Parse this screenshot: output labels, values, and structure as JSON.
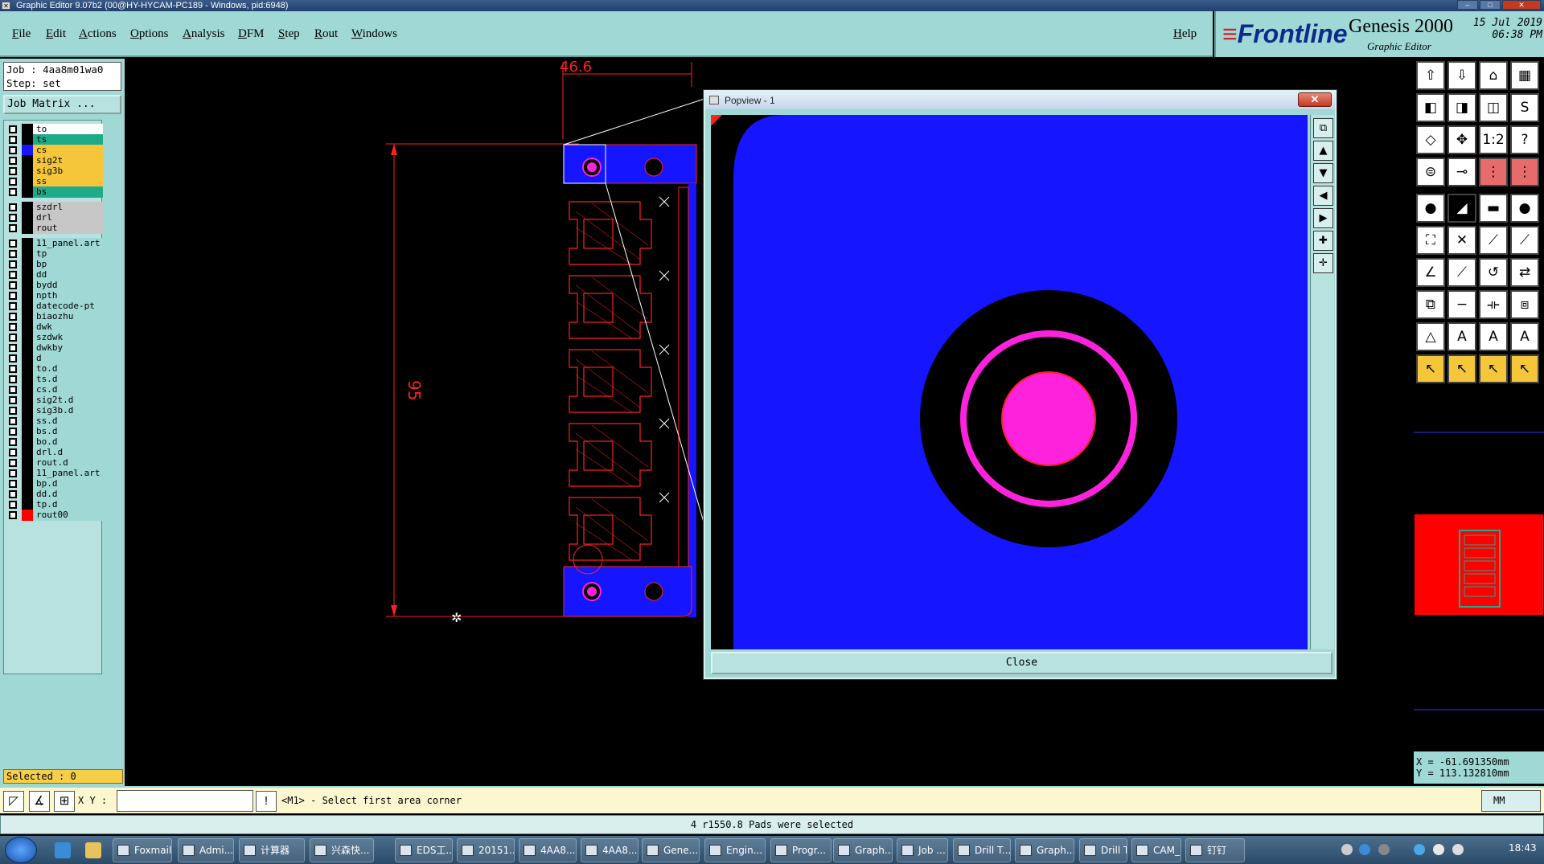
{
  "window": {
    "title": "Graphic Editor 9.07b2 (00@HY-HYCAM-PC189 - Windows, pid:6948)"
  },
  "menu": [
    "File",
    "Edit",
    "Actions",
    "Options",
    "Analysis",
    "DFM",
    "Step",
    "Rout",
    "Windows"
  ],
  "help_label": "Help",
  "brand": {
    "logo": "Frontline",
    "product": "Genesis 2000",
    "subtitle": "Graphic Editor",
    "date": "15 Jul 2019",
    "time": "06:38 PM"
  },
  "job": {
    "job_line": "Job : 4aa8m01wa0",
    "step_line": "Step: set",
    "matrix_button": "Job Matrix ..."
  },
  "layers": [
    {
      "name": "to",
      "color": "#ffffff",
      "swatch": "#000000"
    },
    {
      "name": "ts",
      "color": "#1faa8a",
      "swatch": "#000000"
    },
    {
      "name": "cs",
      "color": "#f5c63a",
      "swatch": "#1515ff"
    },
    {
      "name": "sig2t",
      "color": "#f5c63a",
      "swatch": "#000000"
    },
    {
      "name": "sig3b",
      "color": "#f5c63a",
      "swatch": "#000000"
    },
    {
      "name": "ss",
      "color": "#f5c63a",
      "swatch": "#000000"
    },
    {
      "name": "bs",
      "color": "#1faa8a",
      "swatch": "#000000"
    },
    {
      "name": "szdrl",
      "color": "#c7c7c7",
      "swatch": "#000000"
    },
    {
      "name": "drl",
      "color": "#c7c7c7",
      "swatch": "#000000"
    },
    {
      "name": "rout",
      "color": "#c7c7c7",
      "swatch": "#000000"
    },
    {
      "name": "11_panel.art",
      "color": "#9fd8d5",
      "swatch": "#000000"
    },
    {
      "name": "tp",
      "color": "#9fd8d5",
      "swatch": "#000000"
    },
    {
      "name": "bp",
      "color": "#9fd8d5",
      "swatch": "#000000"
    },
    {
      "name": "dd",
      "color": "#9fd8d5",
      "swatch": "#000000"
    },
    {
      "name": "bydd",
      "color": "#9fd8d5",
      "swatch": "#000000"
    },
    {
      "name": "npth",
      "color": "#9fd8d5",
      "swatch": "#000000"
    },
    {
      "name": "datecode-pt",
      "color": "#9fd8d5",
      "swatch": "#000000"
    },
    {
      "name": "biaozhu",
      "color": "#9fd8d5",
      "swatch": "#000000"
    },
    {
      "name": "dwk",
      "color": "#9fd8d5",
      "swatch": "#000000"
    },
    {
      "name": "szdwk",
      "color": "#9fd8d5",
      "swatch": "#000000"
    },
    {
      "name": "dwkby",
      "color": "#9fd8d5",
      "swatch": "#000000"
    },
    {
      "name": "d",
      "color": "#9fd8d5",
      "swatch": "#000000"
    },
    {
      "name": "to.d",
      "color": "#9fd8d5",
      "swatch": "#000000"
    },
    {
      "name": "ts.d",
      "color": "#9fd8d5",
      "swatch": "#000000"
    },
    {
      "name": "cs.d",
      "color": "#9fd8d5",
      "swatch": "#000000"
    },
    {
      "name": "sig2t.d",
      "color": "#9fd8d5",
      "swatch": "#000000"
    },
    {
      "name": "sig3b.d",
      "color": "#9fd8d5",
      "swatch": "#000000"
    },
    {
      "name": "ss.d",
      "color": "#9fd8d5",
      "swatch": "#000000"
    },
    {
      "name": "bs.d",
      "color": "#9fd8d5",
      "swatch": "#000000"
    },
    {
      "name": "bo.d",
      "color": "#9fd8d5",
      "swatch": "#000000"
    },
    {
      "name": "drl.d",
      "color": "#9fd8d5",
      "swatch": "#000000"
    },
    {
      "name": "rout.d",
      "color": "#9fd8d5",
      "swatch": "#000000"
    },
    {
      "name": "11_panel.art",
      "color": "#9fd8d5",
      "swatch": "#000000"
    },
    {
      "name": "bp.d",
      "color": "#9fd8d5",
      "swatch": "#000000"
    },
    {
      "name": "dd.d",
      "color": "#9fd8d5",
      "swatch": "#000000"
    },
    {
      "name": "tp.d",
      "color": "#9fd8d5",
      "swatch": "#000000"
    },
    {
      "name": "rout00",
      "color": "#9fd8d5",
      "swatch": "#ff0000"
    }
  ],
  "selected_count": "Selected : 0",
  "dimensions": {
    "width_label": "46.6",
    "height_label": "95"
  },
  "popview": {
    "title": "Popview - 1",
    "close_label": "Close",
    "close_x": "✕"
  },
  "coords": {
    "x": "X = -61.691350mm",
    "y": "Y = 113.132810mm"
  },
  "cmdbar": {
    "xy_label": "X Y :",
    "xy_value": "",
    "prompt": "<M1> - Select first area corner",
    "units": "MM"
  },
  "status_message": "4 r1550.8 Pads were selected",
  "taskbar": {
    "tasks": [
      "Foxmail",
      "Admi...",
      "计算器",
      "兴森快...",
      "EDS工...",
      "20151...",
      "4AA8...",
      "4AA8...",
      "Gene...",
      "Engin...",
      "Progr...",
      "Graph...",
      "Job ...",
      "Drill T...",
      "Graph...",
      "Drill T...",
      "CAM_...",
      "钉钉"
    ],
    "clock": "18:43"
  },
  "colors": {
    "panel": "#9fd8d5",
    "board_blue": "#1515ff",
    "pad_magenta": "#ff22dd",
    "outline_red": "#ff0000"
  }
}
